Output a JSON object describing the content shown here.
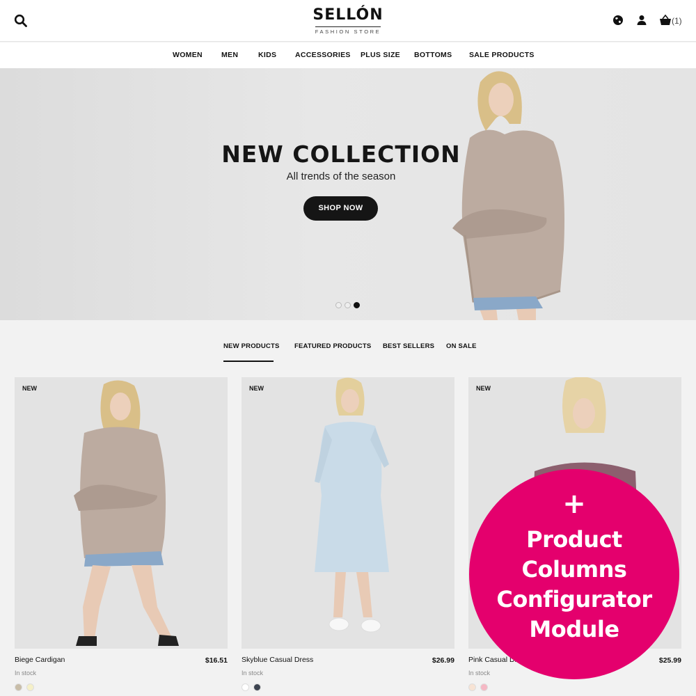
{
  "header": {
    "logo_main": "SELLÓN",
    "logo_sub": "FASHION STORE",
    "cart_count": "(1)",
    "icons": [
      "search-icon",
      "globe-icon",
      "user-icon",
      "cart-icon"
    ]
  },
  "nav": {
    "items": [
      "WOMEN",
      "MEN",
      "KIDS",
      "ACCESSORIES",
      "PLUS SIZE",
      "BOTTOMS",
      "SALE PRODUCTS"
    ]
  },
  "hero": {
    "title": "NEW COLLECTION",
    "subtitle": "All trends of the season",
    "cta": "SHOP NOW",
    "slides": 3,
    "active_slide": 3
  },
  "tabs": {
    "items": [
      "NEW PRODUCTS",
      "FEATURED PRODUCTS",
      "BEST SELLERS",
      "ON SALE"
    ],
    "active": "NEW PRODUCTS"
  },
  "products": [
    {
      "badge": "NEW",
      "name": "Biege Cardigan",
      "price": "$16.51",
      "stock": "In stock",
      "swatches": [
        "#c8bda8",
        "#f5f0c8"
      ]
    },
    {
      "badge": "NEW",
      "name": "Skyblue Casual Dress",
      "price": "$26.99",
      "stock": "In stock",
      "swatches": [
        "#ffffff",
        "#3d4450"
      ]
    },
    {
      "badge": "NEW",
      "name": "Pink Casual Dress",
      "price": "$25.99",
      "stock": "In stock",
      "swatches": [
        "#f7e3d4",
        "#f5b8c4"
      ]
    }
  ],
  "promo": {
    "plus": "+",
    "lines": [
      "Product",
      "Columns",
      "Configurator",
      "Module"
    ],
    "color": "#e4006d"
  }
}
